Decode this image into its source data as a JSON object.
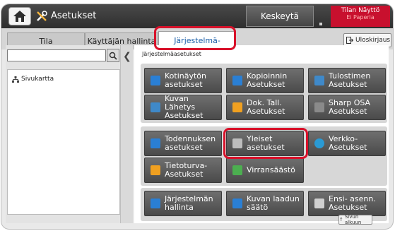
{
  "header": {
    "title": "Asetukset",
    "pause_label": "Keskeytä",
    "status_title": "Tilan Näyttö",
    "status_sub": "Ei Paperia"
  },
  "tabs": [
    {
      "label": "Tila",
      "active": false
    },
    {
      "label": "Käyttäjän hallinta",
      "active": false
    },
    {
      "label": "Järjestelmä-",
      "active": true
    }
  ],
  "logout_label": "Uloskirjaus",
  "sidebar": {
    "search_placeholder": "",
    "items": [
      {
        "label": "Sivukartta",
        "icon": "sitemap-icon"
      }
    ]
  },
  "main": {
    "section_title": "Järjestelmäasetukset",
    "groups": [
      {
        "buttons": [
          {
            "label": "Kotinäytön\nasetukset",
            "icon": "home-icon",
            "color": "#2a7fd4"
          },
          {
            "label": "Kopioinnin\nAsetukset",
            "icon": "copy-icon",
            "color": "#2a7fd4"
          },
          {
            "label": "Tulostimen\nAsetukset",
            "icon": "printer-icon",
            "color": "#3f89c9"
          },
          {
            "label": "Kuvan Lähetys\nAsetukset",
            "icon": "send-icon",
            "color": "#3f89c9"
          },
          {
            "label": "Dok. Tall.\nAsetukset",
            "icon": "folder-icon",
            "color": "#f0a020"
          },
          {
            "label": "Sharp OSA\nAsetukset",
            "icon": "osa-icon",
            "color": "#8a8a8a"
          }
        ]
      },
      {
        "buttons": [
          {
            "label": "Todennuksen\nasetukset",
            "icon": "users-icon",
            "color": "#2a7fd4"
          },
          {
            "label": "Yleiset\nasetukset",
            "icon": "tools-icon",
            "color": "#bdbdbd"
          },
          {
            "label": "Verkko-\nAsetukset",
            "icon": "globe-icon",
            "color": "#2a9ad4"
          },
          {
            "label": "Tietoturva-\nAsetukset",
            "icon": "lock-icon",
            "color": "#f0a020"
          },
          {
            "label": "Virransäästö",
            "icon": "leaf-icon",
            "color": "#4caf50"
          }
        ]
      },
      {
        "buttons": [
          {
            "label": "Järjestelmän\nhallinta",
            "icon": "monitor-icon",
            "color": "#2a7fd4"
          },
          {
            "label": "Kuvan laadun\nsäätö",
            "icon": "image-quality-icon",
            "color": "#2a7fd4"
          },
          {
            "label": "Ensi- asenn.\nAsetukset",
            "icon": "setup-icon",
            "color": "#cfcfcf"
          }
        ]
      }
    ]
  },
  "top_of_page_label": "Sivun alkuun",
  "accent": "#d8112a"
}
